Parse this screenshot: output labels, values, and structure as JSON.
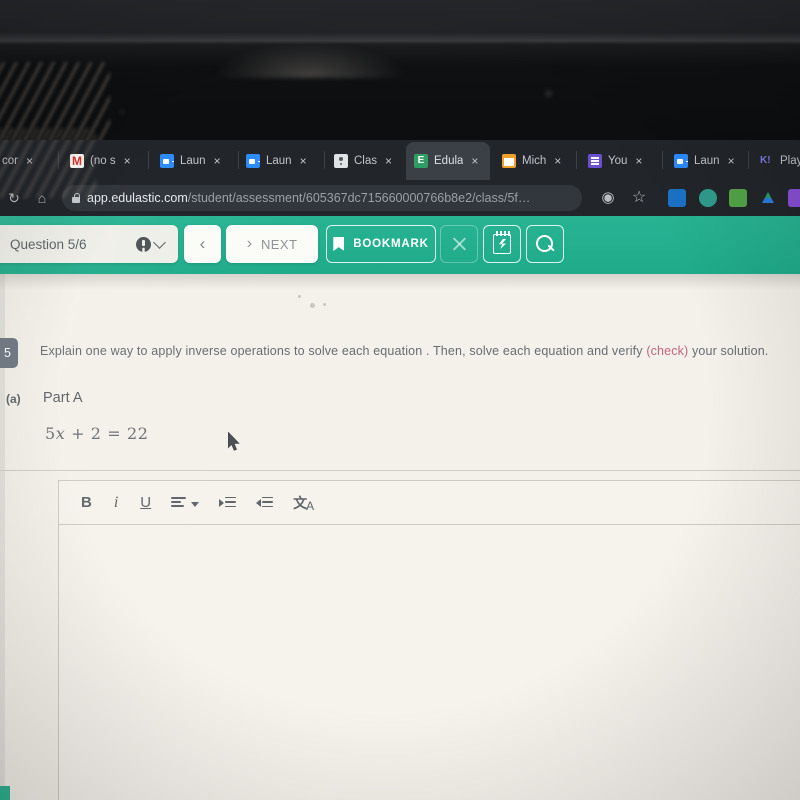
{
  "browser": {
    "tabs": [
      {
        "title": "cor",
        "icon": "generic-favicon",
        "active": false
      },
      {
        "title": "(no s",
        "icon": "gmail-icon",
        "active": false
      },
      {
        "title": "Laun",
        "icon": "zoom-icon",
        "active": false
      },
      {
        "title": "Laun",
        "icon": "zoom-icon",
        "active": false
      },
      {
        "title": "Clas",
        "icon": "google-classroom-icon",
        "active": false
      },
      {
        "title": "Edula",
        "icon": "edulastic-icon",
        "active": true
      },
      {
        "title": "Mich",
        "icon": "orange-doc-icon",
        "active": false
      },
      {
        "title": "You",
        "icon": "youtube-list-icon",
        "active": false
      },
      {
        "title": "Laun",
        "icon": "zoom-icon",
        "active": false
      },
      {
        "title": "Play",
        "icon": "kahoot-icon",
        "active": false
      }
    ],
    "tab_close_label": "×",
    "reload_icon": "reload-icon",
    "home_icon": "home-icon",
    "url_domain": "app.edulastic.com",
    "url_path": "/student/assessment/605367dc715660000766b8e2/class/5f…",
    "lock_icon": "lock-icon",
    "omnibox_icons": [
      "location-pin-icon",
      "star-bookmark-icon"
    ],
    "extensions": [
      {
        "name": "blue-book-extension",
        "color": "#1a73c8"
      },
      {
        "name": "teal-compass-extension",
        "color": "#2f9e8f"
      },
      {
        "name": "green-contact-extension",
        "color": "#53a548"
      },
      {
        "name": "google-drive-extension",
        "color": "#2e7de0"
      },
      {
        "name": "purple-extension",
        "color": "#8a4fd6"
      }
    ]
  },
  "appbar": {
    "question_label": "Question 5/6",
    "info_icon": "info-circle-icon",
    "chevron_icon": "chevron-down-icon",
    "back_label": "‹",
    "next_chevron": "›",
    "next_label": "NEXT",
    "bookmark_label": "BOOKMARK",
    "bookmark_icon": "bookmark-icon",
    "close_icon": "close-x-icon",
    "scratchpad_icon": "scratchpad-notepad-icon",
    "search_icon": "magnifier-icon",
    "accent_color": "#23b18f"
  },
  "question": {
    "number": "5",
    "prompt_before": "Explain one way  to apply  inverse operations to solve each equation . Then, solve each equation and verify ",
    "prompt_highlight": "(check)",
    "prompt_after": " your solution.",
    "highlight_color": "#c2667a",
    "part_marker": "(a)",
    "part_title": "Part A",
    "equation_lhs": "5",
    "equation_var": "x",
    "equation_rest": " + 2  =  22"
  },
  "editor": {
    "bold_label": "B",
    "italic_label": "i",
    "underline_label": "U",
    "align_icon": "text-align-icon",
    "align_caret": "chevron-down-icon",
    "indent_increase_icon": "indent-increase-icon",
    "indent_decrease_icon": "indent-decrease-icon",
    "translate_icon": "translate-clear-format-icon",
    "translate_cjk": "文",
    "translate_latin": "A",
    "body_value": "",
    "body_placeholder": ""
  },
  "pointer": {
    "cursor_icon": "mouse-arrow-cursor"
  }
}
